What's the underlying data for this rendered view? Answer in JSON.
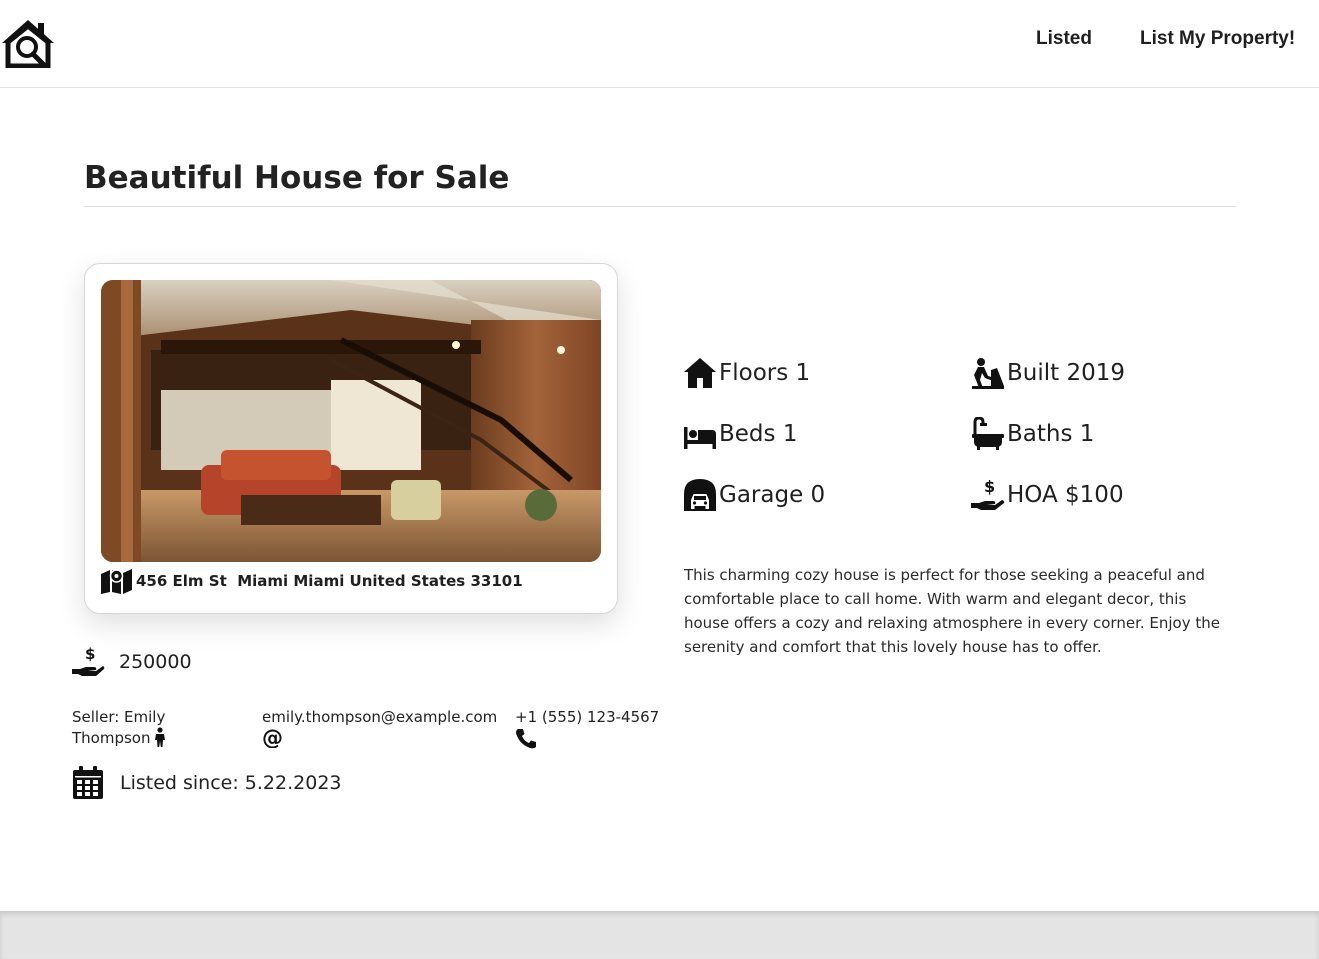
{
  "nav": {
    "logo_icon": "house-search-icon",
    "links": [
      {
        "label": "Listed"
      },
      {
        "label": "List My Property!"
      }
    ]
  },
  "listing": {
    "title": "Beautiful House for Sale",
    "address": "456 Elm St  Miami Miami United States 33101",
    "price": "250000",
    "seller_label": "Seller: Emily",
    "seller_name": "Thompson",
    "email": "emily.thompson@example.com",
    "phone": "+1 (555) 123-4567",
    "listed_since": "Listed since: 5.22.2023",
    "features": {
      "floors": "Floors 1",
      "built": "Built 2019",
      "beds": "Beds 1",
      "baths": "Baths 1",
      "garage": "Garage 0",
      "hoa": "HOA $100"
    },
    "description": "This charming cozy house is perfect for those seeking a peaceful and comfortable place to call home. With warm and elegant decor, this house offers a cozy and relaxing atmosphere in every corner. Enjoy the serenity and comfort that this lovely house has to offer."
  },
  "icons": {
    "address": "map-icon",
    "price": "hand-dollar-icon",
    "seller": "person-icon",
    "email": "at-sign-icon",
    "phone": "phone-icon",
    "listed": "calendar-icon",
    "floors": "house-icon",
    "built": "builder-icon",
    "beds": "bed-icon",
    "baths": "bathtub-icon",
    "garage": "garage-car-icon",
    "hoa": "hand-dollar-icon"
  }
}
